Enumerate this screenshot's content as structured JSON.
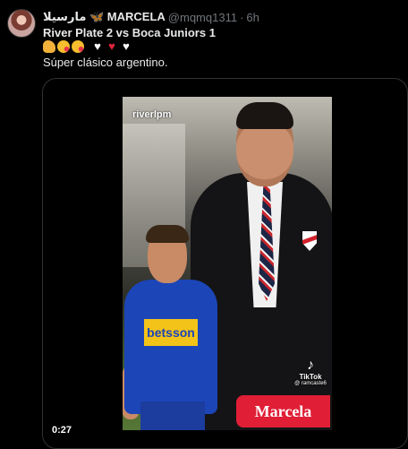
{
  "tweet": {
    "display_name": "مارسيلا 🦋 MARCELA",
    "handle": "@mqmq1311",
    "dot": "·",
    "time": "6h",
    "line1": "River Plate 2 vs Boca Juniors 1",
    "line3": "Súper clásico argentino.",
    "emojis": [
      "flexed-biceps",
      "kissing-heart-face",
      "kissing-heart-face",
      "white-heart",
      "red-heart",
      "white-heart"
    ]
  },
  "video": {
    "watermark": "riverlpm",
    "shirt_text": "betsson",
    "tiktok_label": "TikTok",
    "tiktok_user": "@ ramcaste6",
    "name_overlay": "Marcela",
    "duration": "0:27"
  }
}
